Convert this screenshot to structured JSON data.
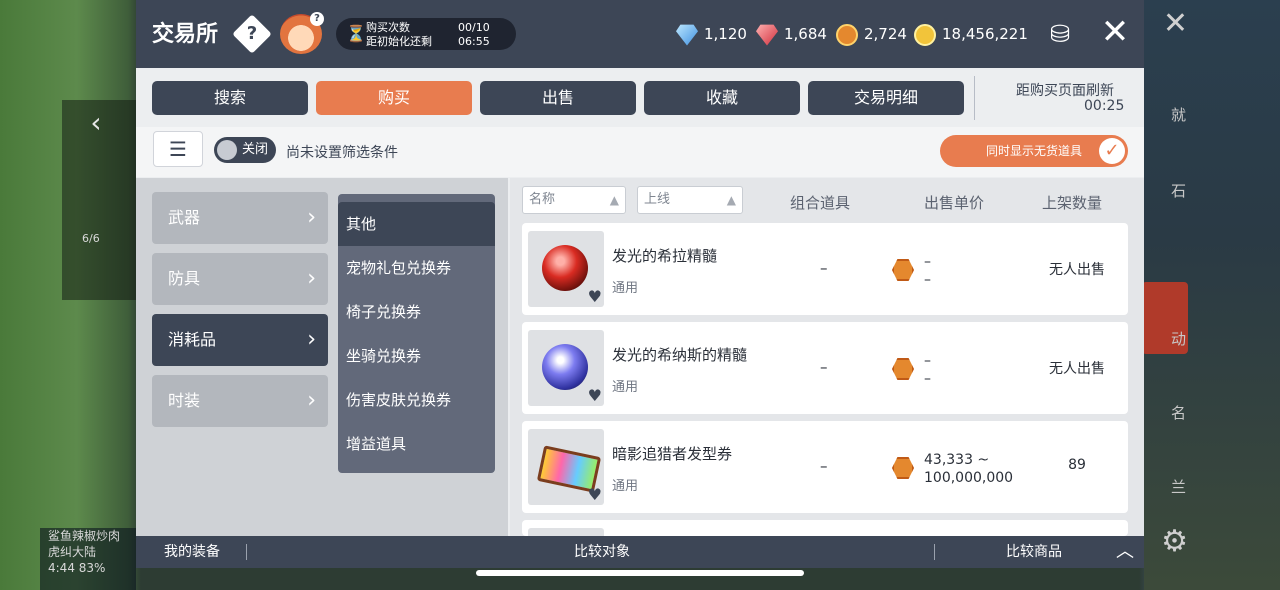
{
  "game_bg": {
    "left_text": "6/6",
    "right_labels": [
      "就",
      "石",
      "动",
      "名",
      "兰"
    ],
    "bottom_left": [
      "鲨鱼辣椒炒肉",
      "虎纠大陆",
      "4:44 83%"
    ]
  },
  "header": {
    "title": "交易所",
    "help_symbol": "?",
    "counter": {
      "line1_label": "购买次数",
      "line1_value": "00/10",
      "line2_label": "距初始化还剩",
      "line2_value": "06:55"
    },
    "currencies": [
      {
        "icon": "blue-diamond-icon",
        "value": "1,120"
      },
      {
        "icon": "red-diamond-icon",
        "value": "1,684"
      },
      {
        "icon": "orange-coin-icon",
        "value": "2,724"
      },
      {
        "icon": "gold-coin-icon",
        "value": "18,456,221"
      }
    ],
    "close_symbol": "✕"
  },
  "tabs": [
    {
      "label": "搜索",
      "active": false
    },
    {
      "label": "购买",
      "active": true
    },
    {
      "label": "出售",
      "active": false
    },
    {
      "label": "收藏",
      "active": false
    },
    {
      "label": "交易明细",
      "active": false
    }
  ],
  "refresh": {
    "label": "距购买页面刷新",
    "time": "00:25"
  },
  "filter": {
    "toggle_label": "关闭",
    "status": "尚未设置筛选条件",
    "stock_label": "同时显示无货道具"
  },
  "categories": [
    {
      "label": "武器",
      "active": false
    },
    {
      "label": "防具",
      "active": false
    },
    {
      "label": "消耗品",
      "active": true
    },
    {
      "label": "时装",
      "active": false
    }
  ],
  "subcategories": [
    {
      "label": "其他",
      "active": true
    },
    {
      "label": "宠物礼包兑换券",
      "active": false
    },
    {
      "label": "椅子兑换券",
      "active": false
    },
    {
      "label": "坐骑兑换券",
      "active": false
    },
    {
      "label": "伤害皮肤兑换券",
      "active": false
    },
    {
      "label": "增益道具",
      "active": false
    }
  ],
  "list": {
    "sort_name": "名称",
    "sort_listed": "上线",
    "headers": [
      "组合道具",
      "出售单价",
      "上架数量"
    ],
    "items": [
      {
        "name": "发光的希拉精髓",
        "type": "通用",
        "combo": "–",
        "price_line1": "–",
        "price_line2": "–",
        "qty": "无人出售"
      },
      {
        "name": "发光的希纳斯的精髓",
        "type": "通用",
        "combo": "–",
        "price_line1": "–",
        "price_line2": "–",
        "qty": "无人出售"
      },
      {
        "name": "暗影追猎者发型券",
        "type": "通用",
        "combo": "–",
        "price_line1": "43,333 ~",
        "price_line2": "100,000,000",
        "qty": "89"
      }
    ]
  },
  "bottom_bar": {
    "my_equipment": "我的装备",
    "compare_target": "比较对象",
    "compare_items": "比较商品"
  }
}
